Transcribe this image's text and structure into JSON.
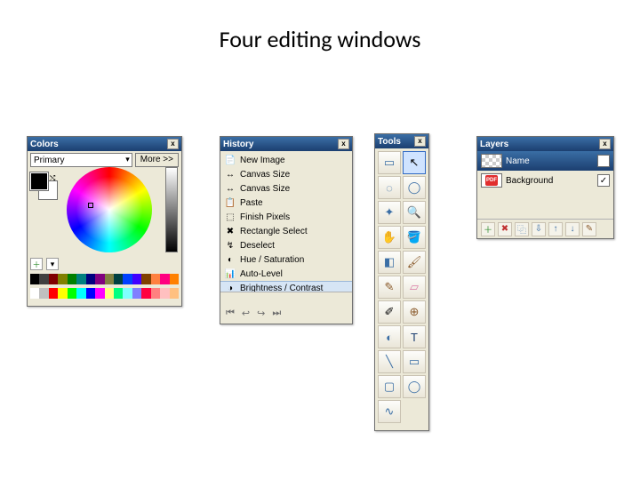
{
  "page": {
    "title": "Four editing windows"
  },
  "colors_panel": {
    "title": "Colors",
    "close": "x",
    "dropdown_value": "Primary",
    "more_label": "More >>"
  },
  "history_panel": {
    "title": "History",
    "close": "x",
    "items": [
      {
        "icon": "📄",
        "label": "New Image",
        "selected": false
      },
      {
        "icon": "↔",
        "label": "Canvas Size",
        "selected": false
      },
      {
        "icon": "↔",
        "label": "Canvas Size",
        "selected": false
      },
      {
        "icon": "📋",
        "label": "Paste",
        "selected": false
      },
      {
        "icon": "⬚",
        "label": "Finish Pixels",
        "selected": false
      },
      {
        "icon": "✖",
        "label": "Rectangle Select",
        "selected": false
      },
      {
        "icon": "↯",
        "label": "Deselect",
        "selected": false
      },
      {
        "icon": "◐",
        "label": "Hue / Saturation",
        "selected": false
      },
      {
        "icon": "📊",
        "label": "Auto-Level",
        "selected": false
      },
      {
        "icon": "◑",
        "label": "Brightness / Contrast",
        "selected": true
      }
    ],
    "nav": {
      "first": "⏮",
      "back": "↩",
      "forward": "↪",
      "last": "⏭"
    }
  },
  "tools_panel": {
    "title": "Tools",
    "close": "x",
    "tools": [
      {
        "name": "rect-select-tool",
        "glyph": "▭",
        "color": "#3a6ea5"
      },
      {
        "name": "move-tool",
        "glyph": "↖",
        "color": "#000",
        "active": true
      },
      {
        "name": "lasso-tool",
        "glyph": "◌",
        "color": "#3a6ea5"
      },
      {
        "name": "ellipse-select-tool",
        "glyph": "◯",
        "color": "#3a6ea5"
      },
      {
        "name": "magic-wand-tool",
        "glyph": "✦",
        "color": "#3a6ea5"
      },
      {
        "name": "zoom-tool",
        "glyph": "🔍",
        "color": "#000"
      },
      {
        "name": "pan-tool",
        "glyph": "✋",
        "color": "#c98a3a"
      },
      {
        "name": "bucket-tool",
        "glyph": "🪣",
        "color": "#3a6ea5"
      },
      {
        "name": "gradient-tool",
        "glyph": "◧",
        "color": "#3a6ea5"
      },
      {
        "name": "brush-tool",
        "glyph": "🖌",
        "color": "#8a5a2b"
      },
      {
        "name": "pencil-tool",
        "glyph": "✎",
        "color": "#8a5a2b"
      },
      {
        "name": "eraser-tool",
        "glyph": "▱",
        "color": "#d97aa6"
      },
      {
        "name": "eyedropper-tool",
        "glyph": "✐",
        "color": "#000"
      },
      {
        "name": "clone-stamp-tool",
        "glyph": "⊕",
        "color": "#8a5a2b"
      },
      {
        "name": "recolor-tool",
        "glyph": "◐",
        "color": "#3a6ea5"
      },
      {
        "name": "text-tool",
        "glyph": "T",
        "color": "#1c3f70"
      },
      {
        "name": "line-tool",
        "glyph": "╲",
        "color": "#3a6ea5"
      },
      {
        "name": "rectangle-tool",
        "glyph": "▭",
        "color": "#3a6ea5"
      },
      {
        "name": "rounded-rect-tool",
        "glyph": "▢",
        "color": "#3a6ea5"
      },
      {
        "name": "ellipse-tool",
        "glyph": "◯",
        "color": "#3a6ea5"
      },
      {
        "name": "freeform-tool",
        "glyph": "∿",
        "color": "#3a6ea5"
      }
    ]
  },
  "layers_panel": {
    "title": "Layers",
    "close": "x",
    "layers": [
      {
        "name": "Name",
        "selected": true,
        "visible": true,
        "thumb": "checker"
      },
      {
        "name": "Background",
        "selected": false,
        "visible": true,
        "thumb": "pdf"
      }
    ],
    "toolbar": [
      {
        "name": "add-layer-button",
        "glyph": "＋",
        "color": "#2a8a2a"
      },
      {
        "name": "delete-layer-button",
        "glyph": "✖",
        "color": "#c03030"
      },
      {
        "name": "duplicate-layer-button",
        "glyph": "⿻",
        "color": "#3a6ea5"
      },
      {
        "name": "merge-down-button",
        "glyph": "⇩",
        "color": "#3a6ea5"
      },
      {
        "name": "move-up-button",
        "glyph": "↑",
        "color": "#3a6ea5"
      },
      {
        "name": "move-down-button",
        "glyph": "↓",
        "color": "#3a6ea5"
      },
      {
        "name": "layer-properties-button",
        "glyph": "✎",
        "color": "#8a5a2b"
      }
    ]
  },
  "palette_colors_top": [
    "#000",
    "#404040",
    "#800000",
    "#808000",
    "#008000",
    "#008080",
    "#000080",
    "#800080",
    "#808040",
    "#004040",
    "#0040ff",
    "#4000ff",
    "#804000",
    "#ff8040",
    "#ff0080",
    "#ff8000"
  ],
  "palette_colors_bottom": [
    "#fff",
    "#c0c0c0",
    "#ff0000",
    "#ffff00",
    "#00ff00",
    "#00ffff",
    "#0000ff",
    "#ff00ff",
    "#ffff80",
    "#00ff80",
    "#80ffff",
    "#8080ff",
    "#ff0040",
    "#ff8080",
    "#ffc0c0",
    "#ffc080"
  ]
}
